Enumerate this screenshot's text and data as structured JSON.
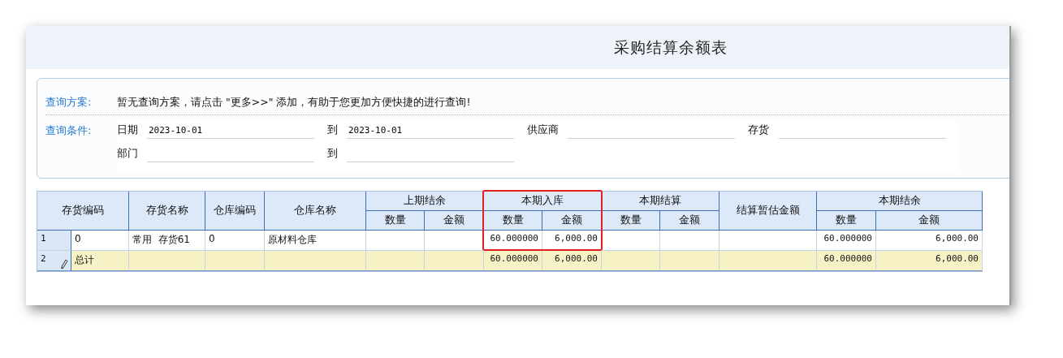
{
  "window": {
    "title": "采购结算余额表"
  },
  "query": {
    "scheme_label": "查询方案:",
    "scheme_text": "暂无查询方案，请点击 \"更多>>\" 添加，有助于您更加方便快捷的进行查询!",
    "condition_label": "查询条件:",
    "fields": [
      {
        "label": "日期",
        "value": "2023-10-01"
      },
      {
        "label": "到",
        "value": "2023-10-01"
      },
      {
        "label": "供应商"
      },
      {
        "label": "存货"
      },
      {
        "label": "部门"
      },
      {
        "label": "到"
      }
    ]
  },
  "table": {
    "columns": [
      {
        "label": "存货编码"
      },
      {
        "label": "存货名称"
      },
      {
        "label": "仓库编码"
      },
      {
        "label": "仓库名称"
      },
      {
        "label": "上期结余",
        "highlighted": false,
        "children": [
          "数量",
          "金额"
        ]
      },
      {
        "label": "本期入库",
        "highlighted": true,
        "children": [
          "数量",
          "金额"
        ]
      },
      {
        "label": "本期结算",
        "highlighted": false,
        "children": [
          "数量",
          "金额"
        ]
      },
      {
        "label": "结算暂估金额"
      },
      {
        "label": "本期结余",
        "highlighted": false,
        "children": [
          "数量",
          "金额"
        ]
      }
    ],
    "rows": [
      {
        "number": "1",
        "kind": "data",
        "editing": false,
        "cells": [
          "0",
          "常用  存货61",
          "0",
          "原材料仓库",
          null,
          null,
          "60.000000",
          "6,000.00",
          null,
          null,
          null,
          "60.000000",
          "6,000.00"
        ]
      },
      {
        "number": "2",
        "kind": "total",
        "editing": true,
        "cells": [
          "总计",
          null,
          null,
          null,
          null,
          null,
          "60.000000",
          "6,000.00",
          null,
          null,
          null,
          "60.000000",
          "6,000.00"
        ]
      }
    ]
  }
}
